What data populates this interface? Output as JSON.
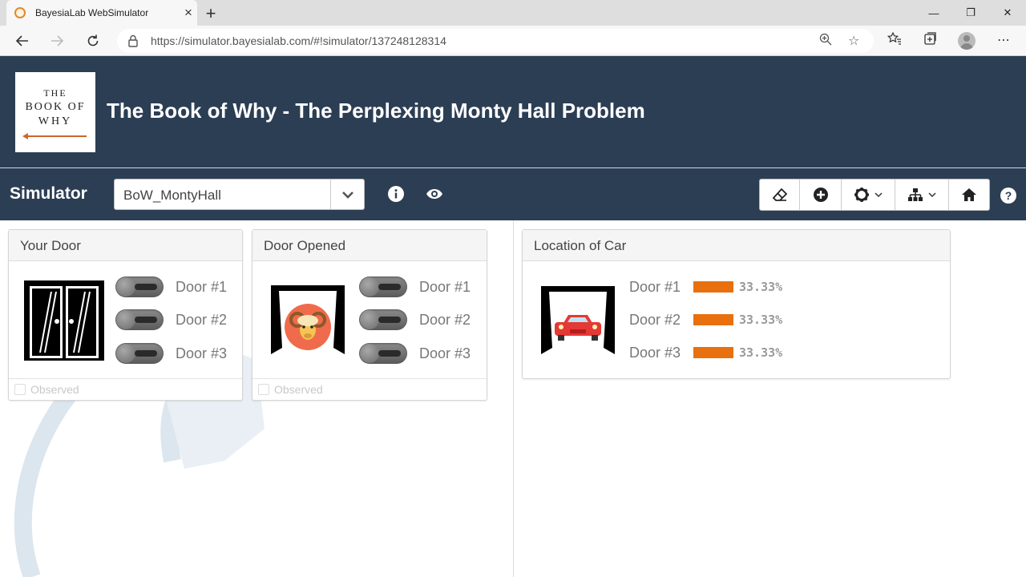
{
  "browser": {
    "tab_title": "BayesiaLab WebSimulator",
    "url": "https://simulator.bayesialab.com/#!simulator/137248128314"
  },
  "header": {
    "title": "The Book of Why - The Perplexing Monty Hall Problem",
    "logo": {
      "line1": "THE",
      "line2": "BOOK OF",
      "line3": "WHY"
    }
  },
  "toolbar": {
    "label": "Simulator",
    "network_select": "BoW_MontyHall",
    "help_label": "?"
  },
  "panels": {
    "your_door": {
      "title": "Your Door",
      "states": [
        "Door #1",
        "Door #2",
        "Door #3"
      ],
      "footer": "Observed"
    },
    "door_opened": {
      "title": "Door Opened",
      "states": [
        "Door #1",
        "Door #2",
        "Door #3"
      ],
      "footer": "Observed"
    },
    "location_of_car": {
      "title": "Location of Car",
      "states": [
        {
          "label": "Door #1",
          "value": 0.3333,
          "display": "33.33%"
        },
        {
          "label": "Door #2",
          "value": 0.3333,
          "display": "33.33%"
        },
        {
          "label": "Door #3",
          "value": 0.3333,
          "display": "33.33%"
        }
      ]
    }
  },
  "colors": {
    "header_bg": "#2c3e54",
    "prob_bar": "#e8700f",
    "car": "#e53935",
    "goat_bg": "#f06b4b"
  }
}
